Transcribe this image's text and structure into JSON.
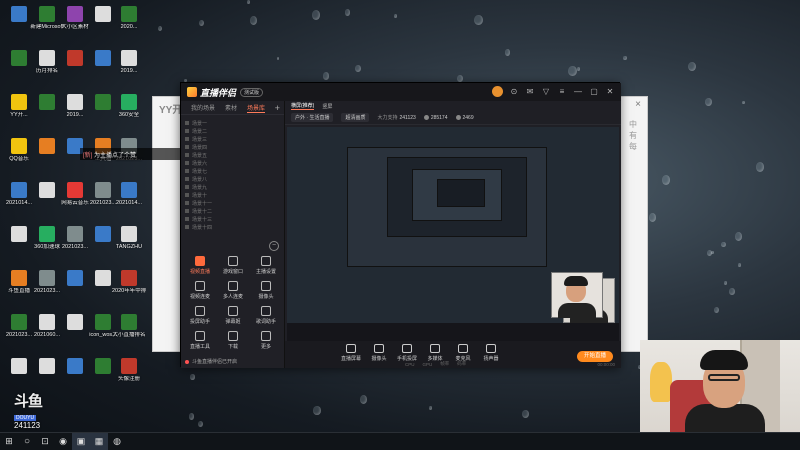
{
  "desktop": {
    "icons": [
      {
        "label": "",
        "color": "#3a7ac8"
      },
      {
        "label": "新建Microsoft",
        "color": "#2e7d32"
      },
      {
        "label": "大小区素材",
        "color": "#8e44ad"
      },
      {
        "label": "",
        "color": "#dddddd"
      },
      {
        "label": "2020...",
        "color": "#2e7d32"
      },
      {
        "label": "",
        "color": "#2e7d32"
      },
      {
        "label": "历月排名",
        "color": "#dddddd"
      },
      {
        "label": "",
        "color": "#c0392b"
      },
      {
        "label": "",
        "color": "#3a7ac8"
      },
      {
        "label": "2019...",
        "color": "#dddddd"
      },
      {
        "label": "YY开...",
        "color": "#f1c40f"
      },
      {
        "label": "",
        "color": "#2e7d32"
      },
      {
        "label": "2019...",
        "color": "#dddddd"
      },
      {
        "label": "",
        "color": "#2e7d32"
      },
      {
        "label": "360安全",
        "color": "#27ae60"
      },
      {
        "label": "QQ音乐",
        "color": "#f1c40f"
      },
      {
        "label": "",
        "color": "#e67e22"
      },
      {
        "label": "",
        "color": "#3a7ac8"
      },
      {
        "label": "工具箱",
        "color": "#e67e22"
      },
      {
        "label": "2021023...",
        "color": "#7f8c8d"
      },
      {
        "label": "2021014...",
        "color": "#3a7ac8"
      },
      {
        "label": "",
        "color": "#dddddd"
      },
      {
        "label": "网易云音乐",
        "color": "#e53935"
      },
      {
        "label": "2021023...",
        "color": "#7f8c8d"
      },
      {
        "label": "2021014...",
        "color": "#3a7ac8"
      },
      {
        "label": "",
        "color": "#dddddd"
      },
      {
        "label": "360加速球",
        "color": "#27ae60"
      },
      {
        "label": "2021023...",
        "color": "#7f8c8d"
      },
      {
        "label": "",
        "color": "#3a7ac8"
      },
      {
        "label": "TANGZHU",
        "color": "#dddddd"
      },
      {
        "label": "斗鱼直播",
        "color": "#e67e22"
      },
      {
        "label": "2021023...",
        "color": "#7f8c8d"
      },
      {
        "label": "",
        "color": "#3a7ac8"
      },
      {
        "label": "",
        "color": "#dddddd"
      },
      {
        "label": "2020年年中排名",
        "color": "#c0392b"
      },
      {
        "label": "2021023...",
        "color": "#2e7d32"
      },
      {
        "label": "2021060...",
        "color": "#dddddd"
      },
      {
        "label": "",
        "color": "#dddddd"
      },
      {
        "label": "icon_wos...",
        "color": "#2e7d32"
      },
      {
        "label": "大小直播排名",
        "color": "#2e7d32"
      },
      {
        "label": "",
        "color": "#dddddd"
      },
      {
        "label": "",
        "color": "#dddddd"
      },
      {
        "label": "",
        "color": "#3a7ac8"
      },
      {
        "label": "",
        "color": "#2e7d32"
      },
      {
        "label": "头像注册",
        "color": "#c0392b"
      }
    ]
  },
  "watermark": {
    "brand": "斗鱼",
    "tag": "DOUYU",
    "room_id": "241123"
  },
  "notice": {
    "prefix": "",
    "accent": "[新]",
    "text": "为主播点了个赞"
  },
  "yy_window": {
    "logo": "YY开",
    "close": "×",
    "right_text": "中 有 每"
  },
  "app": {
    "title": "直播伴侣",
    "badge": "测试版",
    "controls": [
      "⊙",
      "✉",
      "▽",
      "≡",
      "—",
      "▢",
      "✕"
    ],
    "left_tabs": [
      "我的场景",
      "素材",
      "场景库"
    ],
    "left_add": "+",
    "scenes": [
      "场景一",
      "场景二",
      "场景三",
      "场景四",
      "场景五",
      "场景六",
      "场景七",
      "场景八",
      "场景九",
      "场景十",
      "场景十一",
      "场景十二",
      "场景十三",
      "场景十四"
    ],
    "collapse": "−",
    "tools": [
      {
        "label": "视频直播",
        "hot": true
      },
      {
        "label": "游戏窗口",
        "hot": false
      },
      {
        "label": "主播设置",
        "hot": false
      },
      {
        "label": "视频连麦",
        "hot": false
      },
      {
        "label": "多人连麦",
        "hot": false
      },
      {
        "label": "摄像头",
        "hot": false
      },
      {
        "label": "投屏助手",
        "hot": false
      },
      {
        "label": "弹幕姬",
        "hot": false
      },
      {
        "label": "歌词助手",
        "hot": false
      },
      {
        "label": "直播工具",
        "hot": false
      },
      {
        "label": "下载",
        "hot": false
      },
      {
        "label": "更多",
        "hot": false
      }
    ],
    "footer_text": "斗鱼直播伴侣已开启",
    "main_tabs": [
      "横屏(推荐)",
      "竖屏"
    ],
    "info": {
      "category": "户外 · 生活直播",
      "quality": "超清画质",
      "fans_label": "大力支持",
      "fans_value": "241123",
      "heat_value": "285174",
      "online_value": "2469"
    },
    "bottom_tools": [
      "直播屏幕",
      "摄像头",
      "手机投屏",
      "多媒体",
      "麦克风",
      "扬声器"
    ],
    "go_live": "开始直播",
    "status": [
      "CPU",
      "GPU",
      "帧率",
      "码率"
    ],
    "time": "00:00:00"
  },
  "taskbar": {
    "items": [
      "⊞",
      "○",
      "⊡",
      "◉",
      "▣",
      "▦",
      "◍"
    ]
  }
}
